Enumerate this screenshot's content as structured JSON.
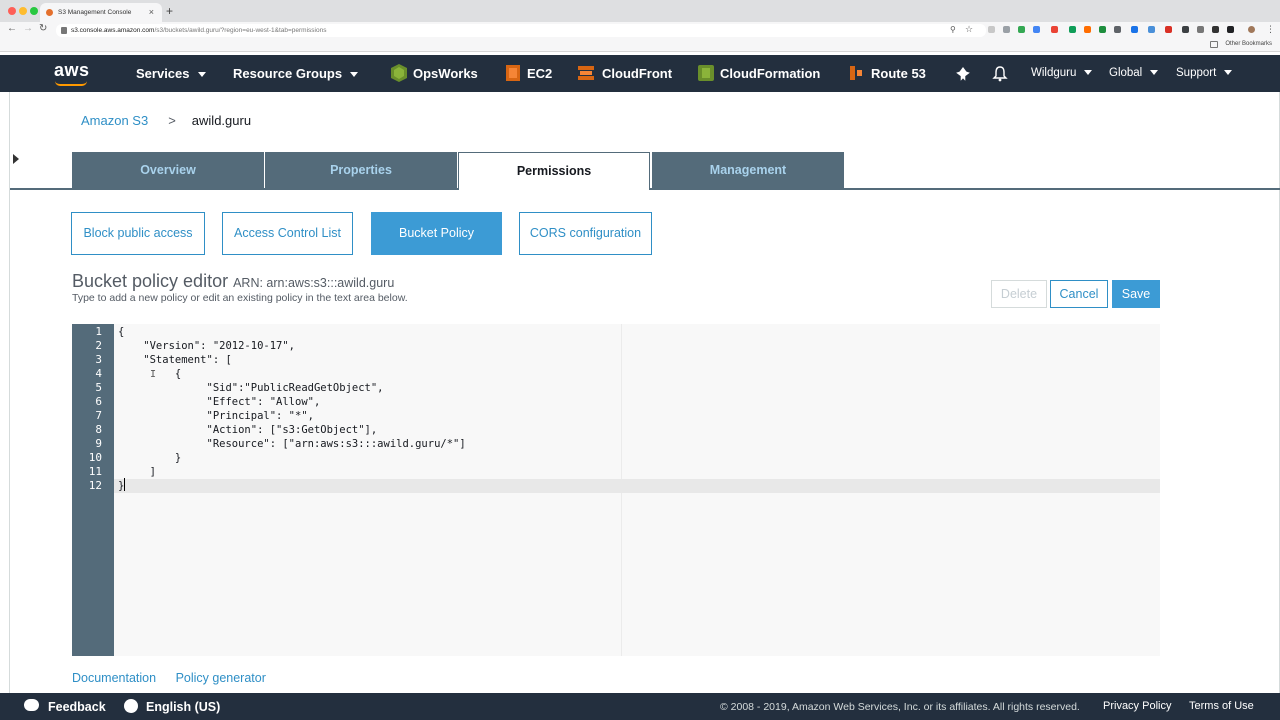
{
  "browser": {
    "tab_title": "S3 Management Console",
    "url_host": "s3.console.aws.amazon.com",
    "url_path": "/s3/buckets/awild.guru/?region=eu-west-1&tab=permissions",
    "other_bookmarks": "Other Bookmarks"
  },
  "nav": {
    "logo": "aws",
    "services": "Services",
    "resource_groups": "Resource Groups",
    "shortcuts": [
      "OpsWorks",
      "EC2",
      "CloudFront",
      "CloudFormation",
      "Route 53"
    ],
    "user": "Wildguru",
    "region": "Global",
    "support": "Support"
  },
  "breadcrumb": {
    "root": "Amazon S3",
    "sep": ">",
    "current": "awild.guru"
  },
  "tabs": [
    "Overview",
    "Properties",
    "Permissions",
    "Management"
  ],
  "subtabs": [
    "Block public access",
    "Access Control List",
    "Bucket Policy",
    "CORS configuration"
  ],
  "editor": {
    "title": "Bucket policy editor",
    "arn": "ARN: arn:aws:s3:::awild.guru",
    "subtitle": "Type to add a new policy or edit an existing policy in the text area below.",
    "delete": "Delete",
    "cancel": "Cancel",
    "save": "Save",
    "lines": [
      "{",
      "    \"Version\": \"2012-10-17\",",
      "    \"Statement\": [",
      "         {",
      "              \"Sid\":\"PublicReadGetObject\",",
      "              \"Effect\": \"Allow\",",
      "              \"Principal\": \"*\",",
      "              \"Action\": [\"s3:GetObject\"],",
      "              \"Resource\": [\"arn:aws:s3:::awild.guru/*\"]",
      "         }",
      "     ]",
      "}"
    ]
  },
  "links": {
    "documentation": "Documentation",
    "policy_generator": "Policy generator"
  },
  "footer": {
    "feedback": "Feedback",
    "language": "English (US)",
    "copyright": "© 2008 - 2019, Amazon Web Services, Inc. or its affiliates. All rights reserved.",
    "privacy": "Privacy Policy",
    "terms": "Terms of Use"
  },
  "colors": {
    "nav_bg": "#232f3e",
    "tab_bg": "#546b7a",
    "accent": "#2f8fc6",
    "aws_orange": "#ff9900"
  }
}
